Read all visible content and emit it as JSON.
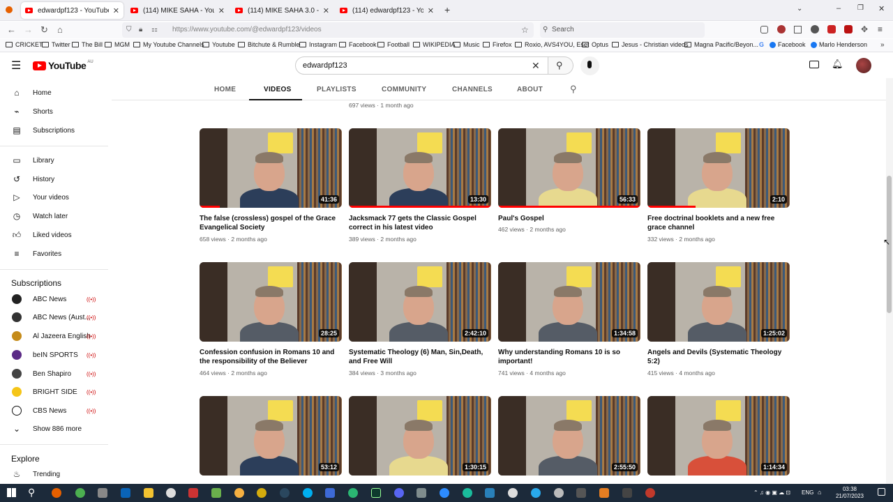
{
  "browser": {
    "tabs": [
      {
        "title": "edwardpf123 - YouTube",
        "active": true
      },
      {
        "title": "(114) MIKE SAHA - YouTube",
        "active": false
      },
      {
        "title": "(114) MIKE SAHA 3.0 - YouTube",
        "active": false
      },
      {
        "title": "(114) edwardpf123 - YouTube",
        "active": false
      }
    ],
    "url": "https://www.youtube.com/@edwardpf123/videos",
    "search_placeholder": "Search",
    "bookmarks": [
      "CRICKET",
      "Twitter",
      "The Bill",
      "MGM",
      "My Youtube Channels",
      "Youtube",
      "Bitchute & Rumble",
      "Instagram",
      "Facebook",
      "Football",
      "WIKIPEDIA",
      "Music",
      "Firefox",
      "Roxio, AVS4YOU, Eset",
      "Optus",
      "Jesus - Christian videos",
      "Magna Pacific/Beyon...",
      "Facebook",
      "Marlo Henderson"
    ]
  },
  "youtube": {
    "logo_text": "YouTube",
    "logo_region": "AU",
    "search_value": "edwardpf123",
    "channel_tabs": [
      "HOME",
      "VIDEOS",
      "PLAYLISTS",
      "COMMUNITY",
      "CHANNELS",
      "ABOUT"
    ],
    "active_tab": "VIDEOS"
  },
  "sidebar": {
    "main": [
      "Home",
      "Shorts",
      "Subscriptions"
    ],
    "library": [
      "Library",
      "History",
      "Your videos",
      "Watch later",
      "Liked videos",
      "Favorites"
    ],
    "subscriptions_heading": "Subscriptions",
    "subscriptions": [
      {
        "name": "ABC News",
        "color": "#222"
      },
      {
        "name": "ABC News (Aust...",
        "color": "#333"
      },
      {
        "name": "Al Jazeera English",
        "color": "#c58b19"
      },
      {
        "name": "beIN SPORTS",
        "color": "#5b2a86"
      },
      {
        "name": "Ben Shapiro",
        "color": "#444"
      },
      {
        "name": "BRIGHT SIDE",
        "color": "#f5c518"
      },
      {
        "name": "CBS News",
        "color": "#111"
      }
    ],
    "show_more": "Show 886 more",
    "explore_heading": "Explore",
    "explore": [
      "Trending"
    ]
  },
  "prev_row_meta": "697 views · 1 month ago",
  "videos": [
    {
      "title": "The false (crossless) gospel of the Grace Evangelical Society",
      "duration": "41:36",
      "meta": "658 views · 2 months ago",
      "progress": 0.14,
      "shirt": "blue"
    },
    {
      "title": "Jacksmack 77 gets the Classic Gospel correct in his latest video",
      "duration": "13:30",
      "meta": "389 views · 2 months ago",
      "progress": 1.0,
      "shirt": "blue"
    },
    {
      "title": "Paul's Gospel",
      "duration": "56:33",
      "meta": "462 views · 2 months ago",
      "progress": 1.0,
      "shirt": "yellow"
    },
    {
      "title": "Free doctrinal booklets and a new free grace channel",
      "duration": "2:10",
      "meta": "332 views · 2 months ago",
      "progress": 0.34,
      "shirt": "yellow"
    },
    {
      "title": "Confession confusion in Romans 10 and the responsibility of the Believer",
      "duration": "28:25",
      "meta": "464 views · 2 months ago",
      "progress": 0.0,
      "shirt": "gray"
    },
    {
      "title": "Systematic Theology (6) Man, Sin,Death, and Free Will",
      "duration": "2:42:10",
      "meta": "384 views · 3 months ago",
      "progress": 0.0,
      "shirt": "gray"
    },
    {
      "title": "Why understanding Romans 10 is so important!",
      "duration": "1:34:58",
      "meta": "741 views · 4 months ago",
      "progress": 0.0,
      "shirt": "gray"
    },
    {
      "title": "Angels and Devils (Systematic Theology 5:2)",
      "duration": "1:25:02",
      "meta": "415 views · 4 months ago",
      "progress": 0.0,
      "shirt": "gray"
    },
    {
      "title": "",
      "duration": "53:12",
      "meta": "",
      "progress": 0.0,
      "shirt": "blue"
    },
    {
      "title": "",
      "duration": "1:30:15",
      "meta": "",
      "progress": 0.0,
      "shirt": "yellow"
    },
    {
      "title": "",
      "duration": "2:55:50",
      "meta": "",
      "progress": 0.0,
      "shirt": "gray"
    },
    {
      "title": "",
      "duration": "1:14:34",
      "meta": "",
      "progress": 0.0,
      "shirt": "red"
    }
  ],
  "taskbar": {
    "lang": "ENG",
    "time": "03:38",
    "date": "21/07/2023"
  }
}
